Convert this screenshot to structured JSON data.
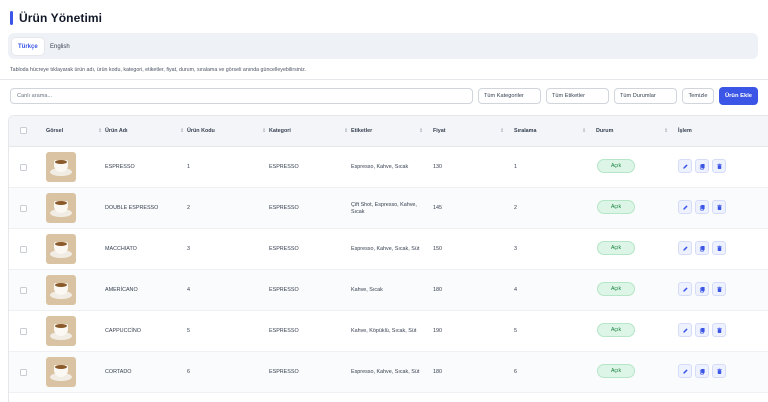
{
  "header": {
    "title": "Ürün Yönetimi"
  },
  "tabs": [
    {
      "label": "Türkçe",
      "active": true
    },
    {
      "label": "English",
      "active": false
    }
  ],
  "hint": "Tabloda hücreye tıklayarak ürün adı, ürün kodu, kategori, etiketler, fiyat, durum, sıralama ve görseli anında güncelleyebilirsiniz.",
  "toolbar": {
    "search_placeholder": "Canlı arama...",
    "category_filter": "Tüm Kategoriler",
    "tag_filter": "Tüm Etiketler",
    "status_filter": "Tüm Durumlar",
    "clear_label": "Temizle",
    "add_label": "Ürün Ekle"
  },
  "table": {
    "headers": {
      "image": "Görsel",
      "name": "Ürün Adı",
      "code": "Ürün Kodu",
      "category": "Kategori",
      "tags": "Etiketler",
      "price": "Fiyat",
      "order": "Sıralama",
      "status": "Durum",
      "action": "İşlem"
    },
    "rows": [
      {
        "name": "ESPRESSO",
        "code": "1",
        "category": "ESPRESSO",
        "tags": "Espresso, Kahve, Sıcak",
        "price": "130",
        "order": "1",
        "status": "Açık"
      },
      {
        "name": "DOUBLE ESPRESSO",
        "code": "2",
        "category": "ESPRESSO",
        "tags": "Çift Shot, Espresso, Kahve, Sıcak",
        "price": "145",
        "order": "2",
        "status": "Açık"
      },
      {
        "name": "MACCHIATO",
        "code": "3",
        "category": "ESPRESSO",
        "tags": "Espresso, Kahve, Sıcak, Süt",
        "price": "150",
        "order": "3",
        "status": "Açık"
      },
      {
        "name": "AMERİCANO",
        "code": "4",
        "category": "ESPRESSO",
        "tags": "Kahve, Sıcak",
        "price": "180",
        "order": "4",
        "status": "Açık"
      },
      {
        "name": "CAPPUCCİNO",
        "code": "5",
        "category": "ESPRESSO",
        "tags": "Kahve, Köpüklü, Sıcak, Süt",
        "price": "190",
        "order": "5",
        "status": "Açık"
      },
      {
        "name": "CORTADO",
        "code": "6",
        "category": "ESPRESSO",
        "tags": "Espresso, Kahve, Sıcak, Süt",
        "price": "180",
        "order": "6",
        "status": "Açık"
      }
    ]
  },
  "colors": {
    "accent": "#3b55e6",
    "status_open_bg": "#dcf5e6",
    "status_open_text": "#15803d"
  },
  "icons": {
    "image": "coffee-cup-image",
    "edit": "edit-icon",
    "copy": "copy-icon",
    "delete": "trash-icon"
  }
}
